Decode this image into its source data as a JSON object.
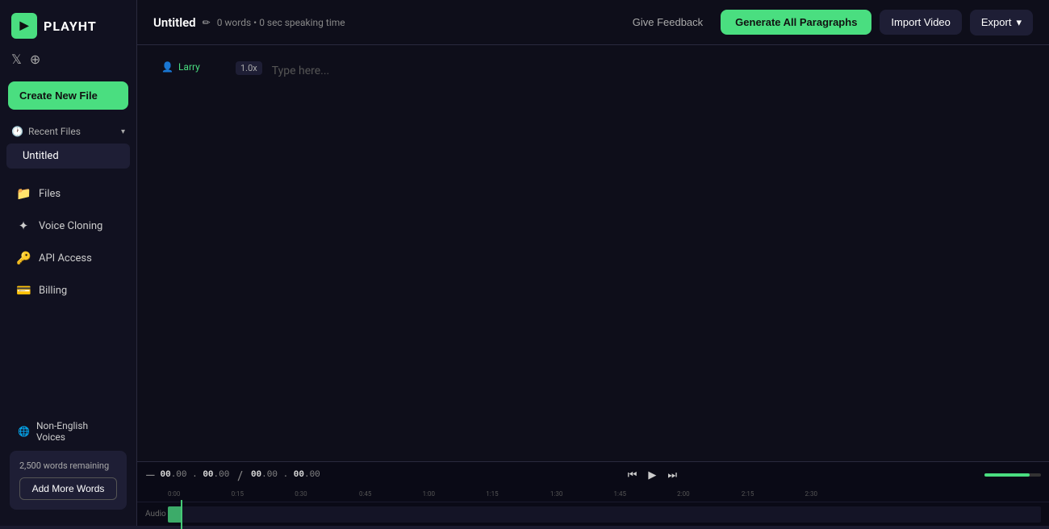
{
  "sidebar": {
    "logo": {
      "icon_text": "▶",
      "text": "PLAYHT"
    },
    "social": {
      "twitter_label": "𝕏",
      "discord_label": "⊕"
    },
    "create_new_label": "Create New File",
    "recent_files": {
      "header_label": "Recent Files",
      "chevron": "▾",
      "items": [
        {
          "label": "Untitled"
        }
      ]
    },
    "nav_items": [
      {
        "id": "files",
        "label": "Files",
        "icon": "📁"
      },
      {
        "id": "voice-cloning",
        "label": "Voice Cloning",
        "icon": "✦"
      },
      {
        "id": "api-access",
        "label": "API Access",
        "icon": "🔑"
      },
      {
        "id": "billing",
        "label": "Billing",
        "icon": "💳"
      }
    ],
    "bottom": {
      "non_english_label": "Non-English Voices",
      "non_english_icon": "🌐",
      "words_remaining": "2,500 words remaining",
      "add_words_label": "Add More Words"
    }
  },
  "topbar": {
    "file_title": "Untitled",
    "edit_icon": "✏",
    "word_count": "0 words • 0 sec speaking time",
    "feedback_label": "Give Feedback",
    "generate_label": "Generate All Paragraphs",
    "import_label": "Import Video",
    "export_label": "Export",
    "export_chevron": "▾"
  },
  "editor": {
    "voice_name": "Larry",
    "speed": "1.0x",
    "placeholder": "Type here..."
  },
  "player": {
    "dash": "—",
    "time_current": "00",
    "time_current_ms": ".00",
    "time_total": "00",
    "time_total_ms": ".00",
    "separator": "/",
    "skip_back_icon": "⏮",
    "play_icon": "▶",
    "skip_forward_icon": "⏭",
    "volume_fill_pct": 80,
    "ruler_labels": [
      {
        "label": "0:00",
        "pct": 0
      },
      {
        "label": "0:15",
        "pct": 7.2
      },
      {
        "label": "0:30",
        "pct": 14.4
      },
      {
        "label": "0:45",
        "pct": 21.7
      },
      {
        "label": "1:00",
        "pct": 28.9
      },
      {
        "label": "1:15",
        "pct": 36.1
      },
      {
        "label": "1:30",
        "pct": 43.4
      },
      {
        "label": "1:45",
        "pct": 50.6
      },
      {
        "label": "2:00",
        "pct": 57.8
      },
      {
        "label": "2:15",
        "pct": 65.1
      },
      {
        "label": "2:30",
        "pct": 72.3
      }
    ],
    "audio_label": "Audio"
  },
  "colors": {
    "accent": "#4ade80",
    "bg_dark": "#0a0a16",
    "bg_sidebar": "#111120",
    "bg_editor": "#0e0e1a",
    "text_primary": "#ffffff",
    "text_secondary": "#aaaaaa",
    "border": "#2a2a3e"
  }
}
